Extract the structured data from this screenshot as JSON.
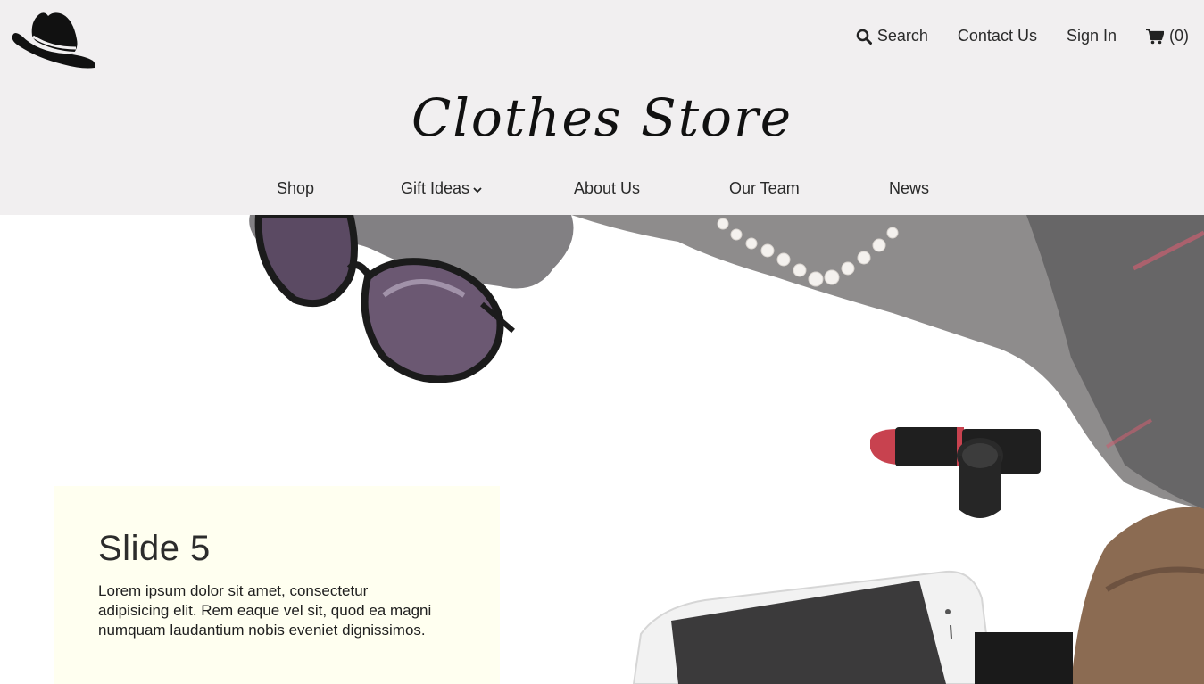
{
  "header": {
    "utility_nav": {
      "search_label": "Search",
      "contact_label": "Contact Us",
      "signin_label": "Sign In",
      "cart_label": "(0)"
    },
    "brand_title": "Clothes Store",
    "main_nav": {
      "items": [
        {
          "label": "Shop"
        },
        {
          "label": "Gift Ideas",
          "has_dropdown": true
        },
        {
          "label": "About Us"
        },
        {
          "label": "Our Team"
        },
        {
          "label": "News"
        }
      ]
    },
    "icons": [
      "hat-logo-icon",
      "search-icon",
      "cart-icon",
      "chevron-down-icon"
    ]
  },
  "hero": {
    "slide": {
      "title": "Slide 5",
      "body": "Lorem ipsum dolor sit amet, consectetur adipisicing elit. Rem eaque vel sit, quod ea magni numquam laudantium nobis eveniet dignissimos."
    }
  },
  "colors": {
    "header_bg": "#f1eff0",
    "card_bg": "#fffff0",
    "text": "#2a2a2a"
  }
}
